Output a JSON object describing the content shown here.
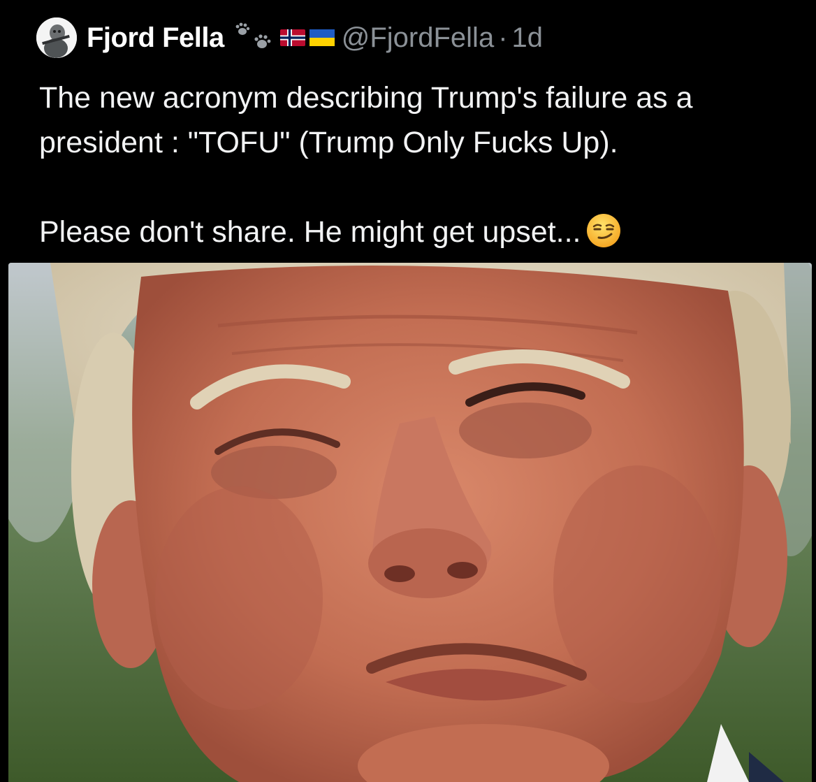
{
  "tweet": {
    "display_name": "Fjord Fella",
    "handle": "@FjordFella",
    "separator": "·",
    "time": "1d",
    "badges": [
      "paw-prints-icon",
      "norway-flag-icon",
      "ukraine-flag-icon"
    ],
    "text_lines": [
      "The new acronym describing Trump's failure as a",
      "president : \"TOFU\"  (Trump Only Fucks Up)."
    ],
    "text_line_2": "Please don't share. He might get upset...",
    "emoji": "smirking-face-icon",
    "media": {
      "type": "photo"
    }
  },
  "colors": {
    "background": "#000000",
    "text": "#e7e9ea",
    "secondary_text": "#8b9197"
  }
}
